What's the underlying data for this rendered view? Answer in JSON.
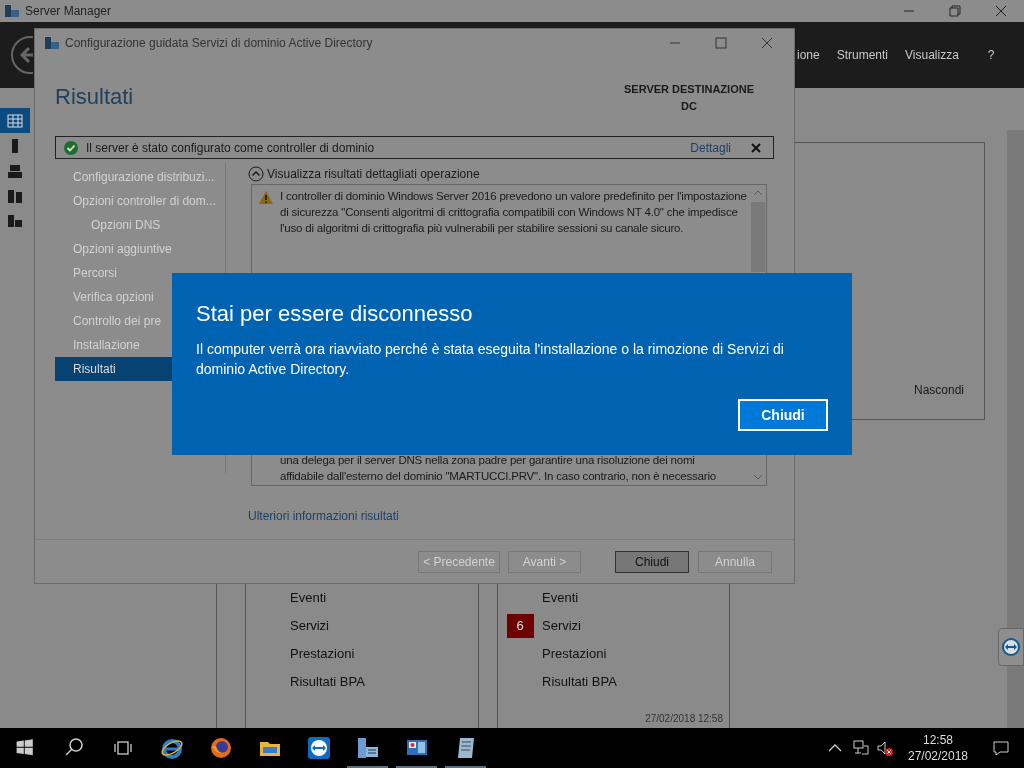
{
  "server_manager": {
    "title": "Server Manager",
    "menu": [
      "ione",
      "Strumenti",
      "Visualizza",
      "?"
    ],
    "hide_label": "Nascondi",
    "tiles": [
      {
        "items": [
          "Eventi",
          "Servizi",
          "Prestazioni",
          "Risultati BPA"
        ]
      },
      {
        "badge": "6",
        "items": [
          "Eventi",
          "Servizi",
          "Prestazioni",
          "Risultati BPA"
        ]
      }
    ],
    "timestamp": "27/02/2018 12:58"
  },
  "wizard": {
    "title": "Configurazione guidata Servizi di dominio Active Directory",
    "heading": "Risultati",
    "server_label": "SERVER DESTINAZIONE",
    "server_name": "DC",
    "notification": {
      "text": "Il server è stato configurato come controller di dominio",
      "link": "Dettagli"
    },
    "nav": [
      {
        "label": "Configurazione distribuzi...",
        "selected": false
      },
      {
        "label": "Opzioni controller di dom...",
        "selected": false,
        "children": [
          {
            "label": "Opzioni DNS",
            "selected": false
          }
        ]
      },
      {
        "label": "Opzioni aggiuntive",
        "selected": false
      },
      {
        "label": "Percorsi",
        "selected": false
      },
      {
        "label": "Verifica opzioni",
        "selected": false
      },
      {
        "label": "Controllo dei pre",
        "selected": false
      },
      {
        "label": "Installazione",
        "selected": false
      },
      {
        "label": "Risultati",
        "selected": true
      }
    ],
    "details_toggle": "Visualizza risultati dettagliati operazione",
    "details_top": "I controller di dominio Windows Server 2016 prevedono un valore predefinito per l'impostazione di sicurezza \"Consenti algoritmi di crittografia compatibili con Windows NT 4.0\" che impedisce l'uso di algoritmi di crittografia più vulnerabili per stabilire sessioni su canale sicuro.",
    "details_bottom": "una delega per il server DNS nella zona padre per garantire una risoluzione dei nomi affidabile dall'esterno del dominio \"MARTUCCI.PRV\". In caso contrario, non è necessario",
    "more_link": "Ulteriori informazioni risultati",
    "buttons": [
      {
        "label": "< Precedente",
        "disabled": true
      },
      {
        "label": "Avanti >",
        "disabled": true
      },
      {
        "label": "Chiudi",
        "disabled": false
      },
      {
        "label": "Annulla",
        "disabled": true
      }
    ]
  },
  "dialog": {
    "title": "Stai per essere disconnesso",
    "message": "Il computer verrà ora riavviato perché è stata eseguita l'installazione o la rimozione di Servizi di dominio Active Directory.",
    "button": "Chiudi"
  },
  "taskbar": {
    "apps": [
      {
        "kind": "ie",
        "open": false
      },
      {
        "kind": "firefox",
        "open": false
      },
      {
        "kind": "explorer",
        "open": false
      },
      {
        "kind": "teamviewer",
        "open": false
      },
      {
        "kind": "servermanager",
        "open": true
      },
      {
        "kind": "panel",
        "open": true
      },
      {
        "kind": "notepad",
        "open": true
      }
    ],
    "time": "12:58",
    "date": "27/02/2018"
  }
}
